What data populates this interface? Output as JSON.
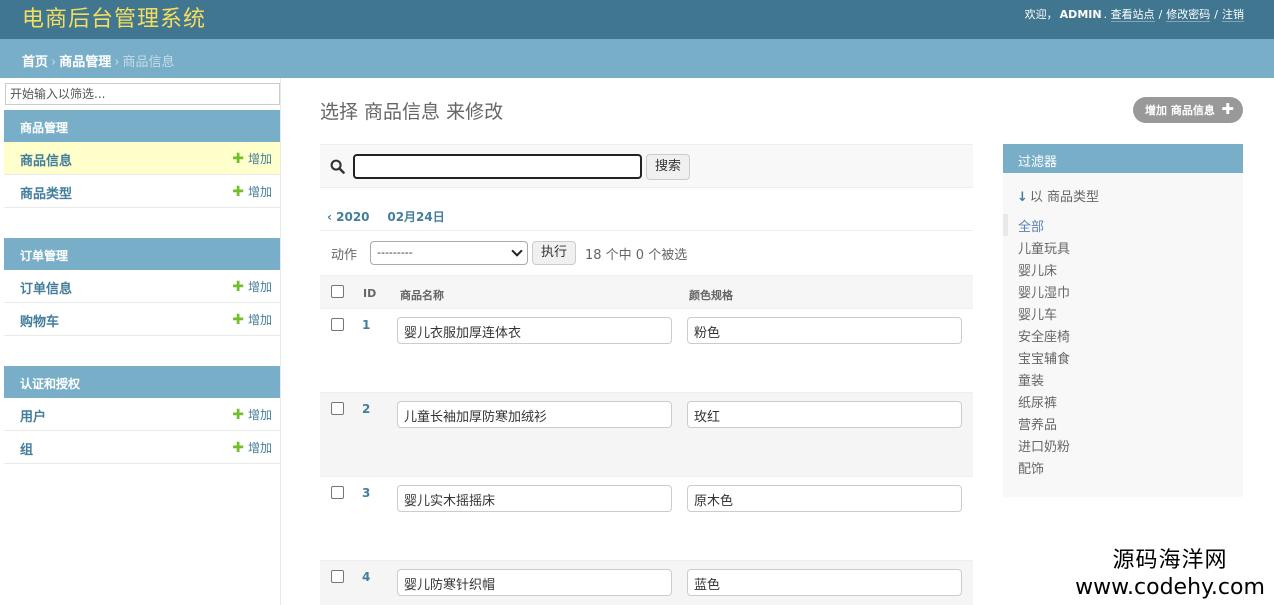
{
  "header": {
    "site_title": "电商后台管理系统",
    "welcome": "欢迎，",
    "username": "ADMIN",
    "dot": ".",
    "view_site": "查看站点",
    "change_password": "修改密码",
    "logout": "注销",
    "sep": "/"
  },
  "breadcrumbs": {
    "home": "首页",
    "app": "商品管理",
    "current": "商品信息",
    "sep": "›"
  },
  "sidebar": {
    "filter_placeholder": "开始输入以筛选...",
    "add_label": "增加",
    "modules": [
      {
        "caption": "商品管理",
        "rows": [
          "商品信息",
          "商品类型"
        ]
      },
      {
        "caption": "订单管理",
        "rows": [
          "订单信息",
          "购物车"
        ]
      },
      {
        "caption": "认证和授权",
        "rows": [
          "用户",
          "组"
        ]
      }
    ]
  },
  "main": {
    "title": "选择 商品信息 来修改",
    "add_button": "增加 商品信息",
    "search_value": "",
    "search_button": "搜索",
    "date_year": "‹ 2020",
    "date_day": "02月24日",
    "action_label": "动作",
    "action_selected": "---------",
    "action_go": "执行",
    "action_counter": "18 个中 0 个被选",
    "columns": {
      "id": "ID",
      "name": "商品名称",
      "color": "颜色规格"
    },
    "rows": [
      {
        "id": "1",
        "name": "婴儿衣服加厚连体衣",
        "color": "粉色"
      },
      {
        "id": "2",
        "name": "儿童长袖加厚防寒加绒衫",
        "color": "玫红"
      },
      {
        "id": "3",
        "name": "婴儿实木摇摇床",
        "color": "原木色"
      },
      {
        "id": "4",
        "name": "婴儿防寒针织帽",
        "color": "蓝色"
      }
    ]
  },
  "filter": {
    "title": "过滤器",
    "by_arrow": "↓",
    "by_label": "以 商品类型",
    "items": [
      "全部",
      "儿童玩具",
      "婴儿床",
      "婴儿湿巾",
      "婴儿车",
      "安全座椅",
      "宝宝辅食",
      "童装",
      "纸尿裤",
      "营养品",
      "进口奶粉",
      "配饰"
    ]
  },
  "watermark": {
    "line1": "源码海洋网",
    "line2": "www.codehy.com"
  },
  "colors": {
    "header_bg": "#417690",
    "title_yellow": "#f5dd5d",
    "breadcrumb_bg": "#79aec8",
    "link_blue": "#447e9b",
    "add_green": "#70bf2b",
    "selected_row": "#ffffcc"
  }
}
